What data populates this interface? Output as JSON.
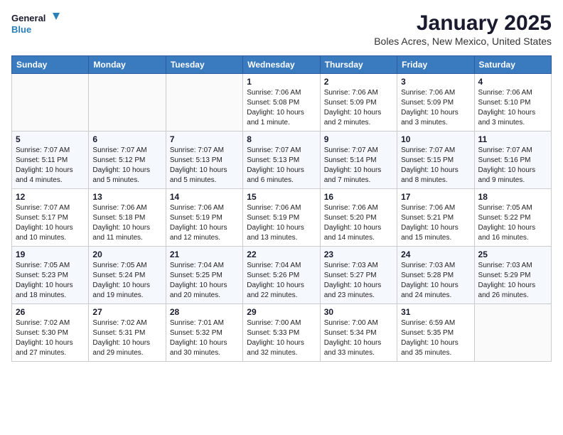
{
  "logo": {
    "line1": "General",
    "line2": "Blue"
  },
  "title": "January 2025",
  "subtitle": "Boles Acres, New Mexico, United States",
  "weekdays": [
    "Sunday",
    "Monday",
    "Tuesday",
    "Wednesday",
    "Thursday",
    "Friday",
    "Saturday"
  ],
  "weeks": [
    [
      {
        "day": "",
        "info": ""
      },
      {
        "day": "",
        "info": ""
      },
      {
        "day": "",
        "info": ""
      },
      {
        "day": "1",
        "info": "Sunrise: 7:06 AM\nSunset: 5:08 PM\nDaylight: 10 hours\nand 1 minute."
      },
      {
        "day": "2",
        "info": "Sunrise: 7:06 AM\nSunset: 5:09 PM\nDaylight: 10 hours\nand 2 minutes."
      },
      {
        "day": "3",
        "info": "Sunrise: 7:06 AM\nSunset: 5:09 PM\nDaylight: 10 hours\nand 3 minutes."
      },
      {
        "day": "4",
        "info": "Sunrise: 7:06 AM\nSunset: 5:10 PM\nDaylight: 10 hours\nand 3 minutes."
      }
    ],
    [
      {
        "day": "5",
        "info": "Sunrise: 7:07 AM\nSunset: 5:11 PM\nDaylight: 10 hours\nand 4 minutes."
      },
      {
        "day": "6",
        "info": "Sunrise: 7:07 AM\nSunset: 5:12 PM\nDaylight: 10 hours\nand 5 minutes."
      },
      {
        "day": "7",
        "info": "Sunrise: 7:07 AM\nSunset: 5:13 PM\nDaylight: 10 hours\nand 5 minutes."
      },
      {
        "day": "8",
        "info": "Sunrise: 7:07 AM\nSunset: 5:13 PM\nDaylight: 10 hours\nand 6 minutes."
      },
      {
        "day": "9",
        "info": "Sunrise: 7:07 AM\nSunset: 5:14 PM\nDaylight: 10 hours\nand 7 minutes."
      },
      {
        "day": "10",
        "info": "Sunrise: 7:07 AM\nSunset: 5:15 PM\nDaylight: 10 hours\nand 8 minutes."
      },
      {
        "day": "11",
        "info": "Sunrise: 7:07 AM\nSunset: 5:16 PM\nDaylight: 10 hours\nand 9 minutes."
      }
    ],
    [
      {
        "day": "12",
        "info": "Sunrise: 7:07 AM\nSunset: 5:17 PM\nDaylight: 10 hours\nand 10 minutes."
      },
      {
        "day": "13",
        "info": "Sunrise: 7:06 AM\nSunset: 5:18 PM\nDaylight: 10 hours\nand 11 minutes."
      },
      {
        "day": "14",
        "info": "Sunrise: 7:06 AM\nSunset: 5:19 PM\nDaylight: 10 hours\nand 12 minutes."
      },
      {
        "day": "15",
        "info": "Sunrise: 7:06 AM\nSunset: 5:19 PM\nDaylight: 10 hours\nand 13 minutes."
      },
      {
        "day": "16",
        "info": "Sunrise: 7:06 AM\nSunset: 5:20 PM\nDaylight: 10 hours\nand 14 minutes."
      },
      {
        "day": "17",
        "info": "Sunrise: 7:06 AM\nSunset: 5:21 PM\nDaylight: 10 hours\nand 15 minutes."
      },
      {
        "day": "18",
        "info": "Sunrise: 7:05 AM\nSunset: 5:22 PM\nDaylight: 10 hours\nand 16 minutes."
      }
    ],
    [
      {
        "day": "19",
        "info": "Sunrise: 7:05 AM\nSunset: 5:23 PM\nDaylight: 10 hours\nand 18 minutes."
      },
      {
        "day": "20",
        "info": "Sunrise: 7:05 AM\nSunset: 5:24 PM\nDaylight: 10 hours\nand 19 minutes."
      },
      {
        "day": "21",
        "info": "Sunrise: 7:04 AM\nSunset: 5:25 PM\nDaylight: 10 hours\nand 20 minutes."
      },
      {
        "day": "22",
        "info": "Sunrise: 7:04 AM\nSunset: 5:26 PM\nDaylight: 10 hours\nand 22 minutes."
      },
      {
        "day": "23",
        "info": "Sunrise: 7:03 AM\nSunset: 5:27 PM\nDaylight: 10 hours\nand 23 minutes."
      },
      {
        "day": "24",
        "info": "Sunrise: 7:03 AM\nSunset: 5:28 PM\nDaylight: 10 hours\nand 24 minutes."
      },
      {
        "day": "25",
        "info": "Sunrise: 7:03 AM\nSunset: 5:29 PM\nDaylight: 10 hours\nand 26 minutes."
      }
    ],
    [
      {
        "day": "26",
        "info": "Sunrise: 7:02 AM\nSunset: 5:30 PM\nDaylight: 10 hours\nand 27 minutes."
      },
      {
        "day": "27",
        "info": "Sunrise: 7:02 AM\nSunset: 5:31 PM\nDaylight: 10 hours\nand 29 minutes."
      },
      {
        "day": "28",
        "info": "Sunrise: 7:01 AM\nSunset: 5:32 PM\nDaylight: 10 hours\nand 30 minutes."
      },
      {
        "day": "29",
        "info": "Sunrise: 7:00 AM\nSunset: 5:33 PM\nDaylight: 10 hours\nand 32 minutes."
      },
      {
        "day": "30",
        "info": "Sunrise: 7:00 AM\nSunset: 5:34 PM\nDaylight: 10 hours\nand 33 minutes."
      },
      {
        "day": "31",
        "info": "Sunrise: 6:59 AM\nSunset: 5:35 PM\nDaylight: 10 hours\nand 35 minutes."
      },
      {
        "day": "",
        "info": ""
      }
    ]
  ]
}
